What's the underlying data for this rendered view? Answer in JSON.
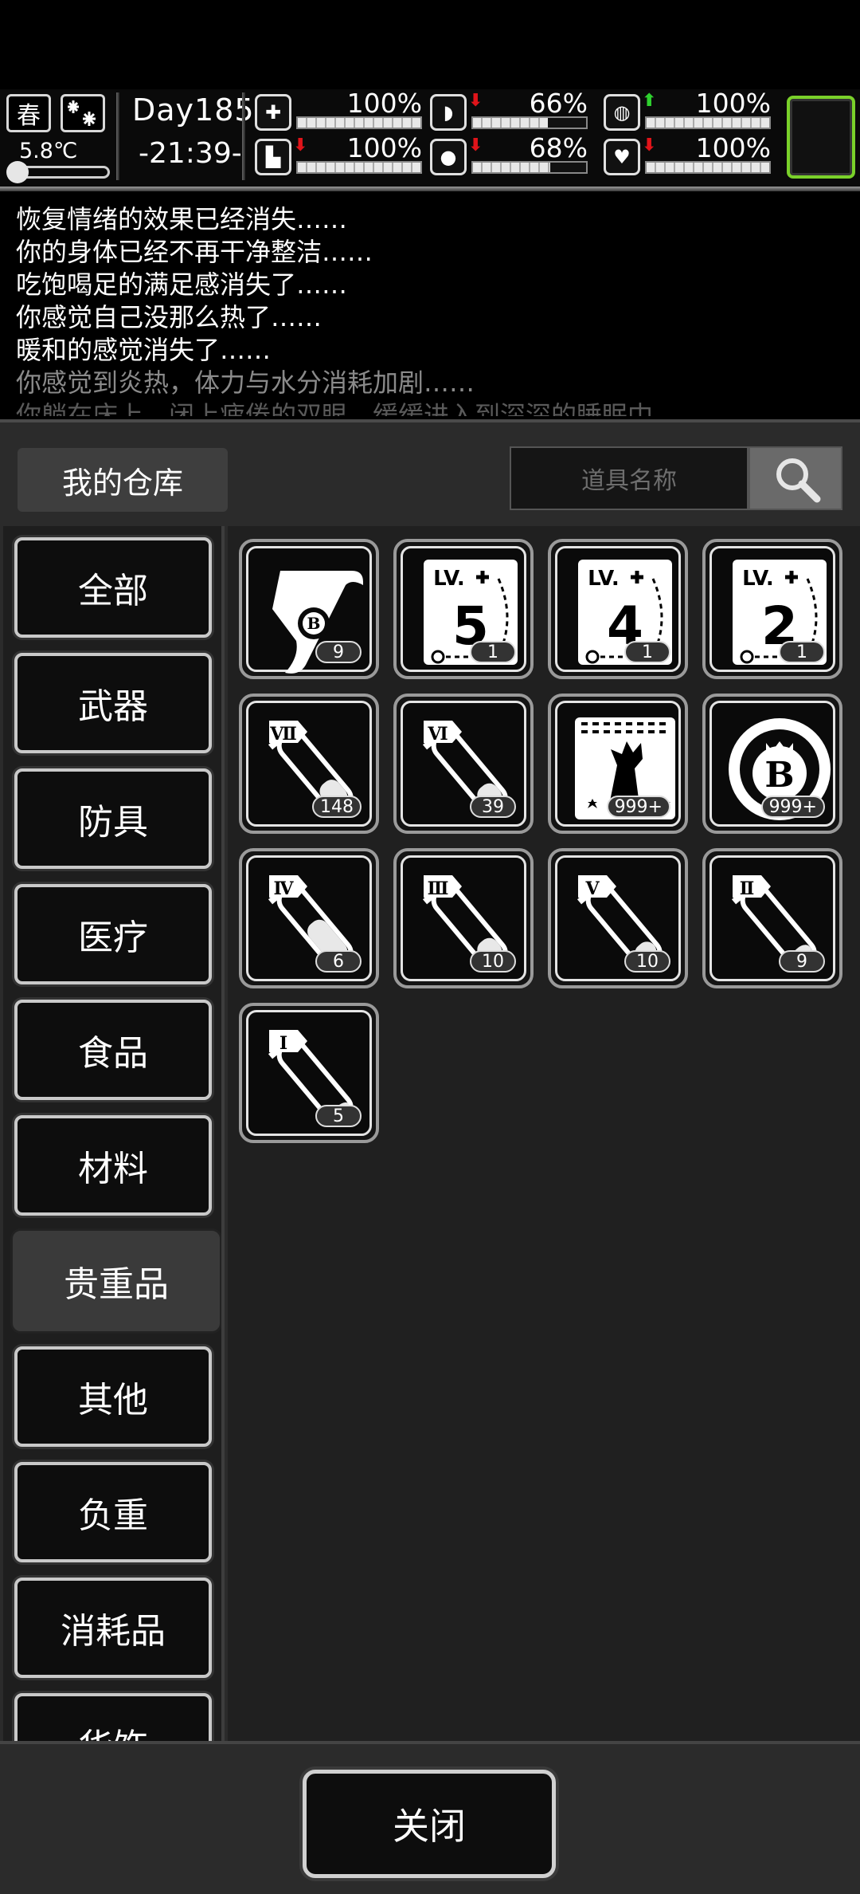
{
  "status": {
    "season": "春",
    "temperature": "5.8℃",
    "day": "Day185",
    "time": "-21:39-",
    "stats": [
      {
        "name": "health",
        "value": "100%",
        "level": 1.0,
        "arrow": ""
      },
      {
        "name": "stomach",
        "value": "66%",
        "level": 0.66,
        "arrow": "down"
      },
      {
        "name": "sleep",
        "value": "100%",
        "level": 1.0,
        "arrow": "up"
      },
      {
        "name": "stamina",
        "value": "100%",
        "level": 1.0,
        "arrow": "down"
      },
      {
        "name": "water",
        "value": "68%",
        "level": 0.68,
        "arrow": "down"
      },
      {
        "name": "mood",
        "value": "100%",
        "level": 1.0,
        "arrow": "down"
      }
    ],
    "arrow_colors": {
      "down": "#e0141a",
      "up": "#2fd12f"
    },
    "accent": "#7ad12a"
  },
  "log": {
    "lines": [
      "恢复情绪的效果已经消失……",
      "你的身体已经不再干净整洁……",
      "吃饱喝足的满足感消失了……",
      "你感觉自己没那么热了……",
      "暖和的感觉消失了……",
      "你感觉到炎热，体力与水分消耗加剧……",
      "你躺在床上，闭上疲倦的双眼，缓缓进入到深深的睡眠中……"
    ]
  },
  "warehouse": {
    "title": "我的仓库",
    "search_placeholder": "道具名称",
    "categories": [
      "全部",
      "武器",
      "防具",
      "医疗",
      "食品",
      "材料",
      "贵重品",
      "其他",
      "负重",
      "消耗品",
      "华饰"
    ],
    "active_category": "贵重品",
    "items": [
      {
        "icon": "scroll-icon",
        "count": "9"
      },
      {
        "icon": "skill-book-icon",
        "label": "5",
        "count": "1"
      },
      {
        "icon": "skill-book-icon",
        "label": "4",
        "count": "1"
      },
      {
        "icon": "skill-book-icon",
        "label": "2",
        "count": "1"
      },
      {
        "icon": "test-tube-icon",
        "label": "Ⅶ",
        "level": 0.35,
        "count": "148"
      },
      {
        "icon": "test-tube-icon",
        "label": "Ⅵ",
        "level": 0.3,
        "count": "39"
      },
      {
        "icon": "zombie-poster-icon",
        "count": "999+"
      },
      {
        "icon": "coin-icon",
        "count": "999+"
      },
      {
        "icon": "test-tube-icon",
        "label": "Ⅳ",
        "level": 0.55,
        "count": "6"
      },
      {
        "icon": "test-tube-icon",
        "label": "Ⅲ",
        "level": 0.3,
        "count": "10"
      },
      {
        "icon": "test-tube-icon",
        "label": "Ⅴ",
        "level": 0.25,
        "count": "10"
      },
      {
        "icon": "test-tube-icon",
        "label": "Ⅱ",
        "level": 0.2,
        "count": "9"
      },
      {
        "icon": "test-tube-icon",
        "label": "Ⅰ",
        "level": 0.15,
        "count": "5"
      }
    ],
    "close_label": "关闭"
  }
}
